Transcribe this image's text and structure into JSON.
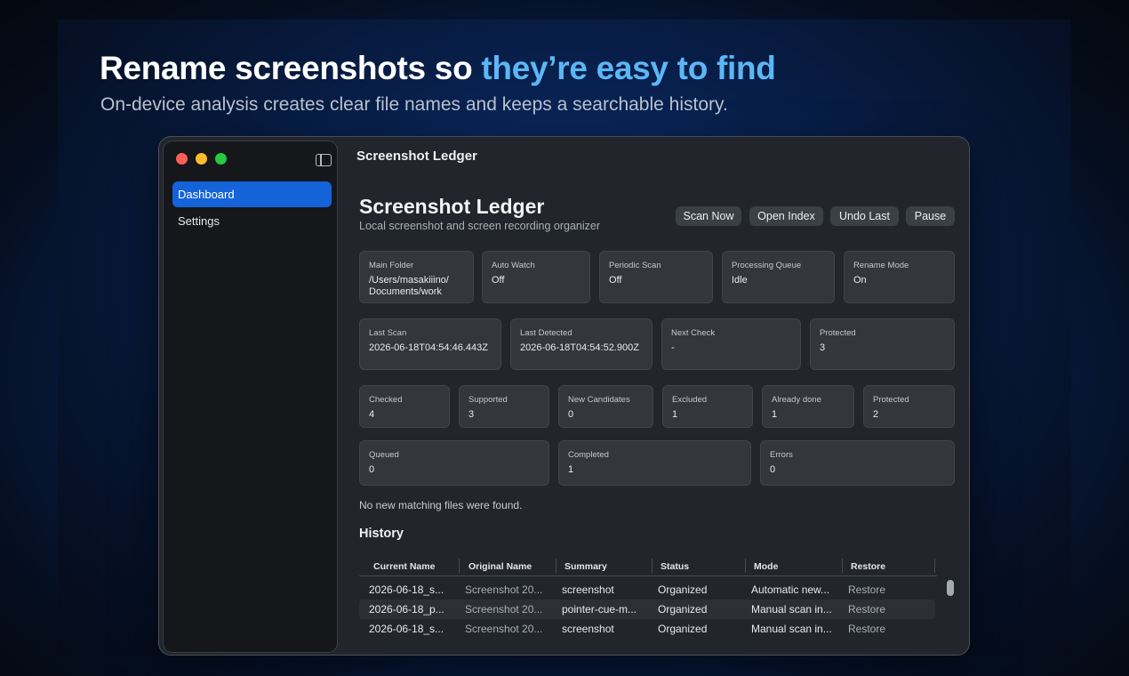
{
  "marketing": {
    "headline_part1": "Rename screenshots so ",
    "headline_accent": "they’re easy to find",
    "subheadline": "On-device analysis creates clear file names and keeps a searchable history."
  },
  "window": {
    "title": "Screenshot Ledger",
    "sidebar_toggle_icon": "sidebar-toggle-icon"
  },
  "sidebar": {
    "items": [
      {
        "label": "Dashboard",
        "active": true
      },
      {
        "label": "Settings",
        "active": false
      }
    ]
  },
  "main": {
    "title": "Screenshot Ledger",
    "subtitle": "Local screenshot and screen recording organizer",
    "buttons": [
      "Scan Now",
      "Open Index",
      "Undo Last",
      "Pause"
    ]
  },
  "status_row1": [
    {
      "label": "Main Folder",
      "value": "/Users/masakiiino/\nDocuments/work"
    },
    {
      "label": "Auto Watch",
      "value": "Off"
    },
    {
      "label": "Periodic Scan",
      "value": "Off"
    },
    {
      "label": "Processing Queue",
      "value": "Idle"
    },
    {
      "label": "Rename Mode",
      "value": "On"
    }
  ],
  "status_row2": [
    {
      "label": "Last Scan",
      "value": "2026-06-18T04:54:46.443Z"
    },
    {
      "label": "Last Detected",
      "value": "2026-06-18T04:54:52.900Z"
    },
    {
      "label": "Next Check",
      "value": "-"
    },
    {
      "label": "Protected",
      "value": "3"
    }
  ],
  "stats_row": [
    {
      "label": "Checked",
      "value": "4"
    },
    {
      "label": "Supported",
      "value": "3"
    },
    {
      "label": "New Candidates",
      "value": "0"
    },
    {
      "label": "Excluded",
      "value": "1"
    },
    {
      "label": "Already done",
      "value": "1"
    },
    {
      "label": "Protected",
      "value": "2"
    }
  ],
  "queue_row": [
    {
      "label": "Queued",
      "value": "0"
    },
    {
      "label": "Completed",
      "value": "1"
    },
    {
      "label": "Errors",
      "value": "0"
    }
  ],
  "notice": "No new matching files were found.",
  "history": {
    "title": "History",
    "columns": [
      "Current Name",
      "Original Name",
      "Summary",
      "Status",
      "Mode",
      "Restore"
    ],
    "rows": [
      [
        "2026-06-18_s...",
        "Screenshot 20...",
        "screenshot",
        "Organized",
        "Automatic new...",
        "Restore"
      ],
      [
        "2026-06-18_p...",
        "Screenshot 20...",
        "pointer-cue-m...",
        "Organized",
        "Manual scan in...",
        "Restore"
      ],
      [
        "2026-06-18_s...",
        "Screenshot 20...",
        "screenshot",
        "Organized",
        "Manual scan in...",
        "Restore"
      ]
    ]
  }
}
